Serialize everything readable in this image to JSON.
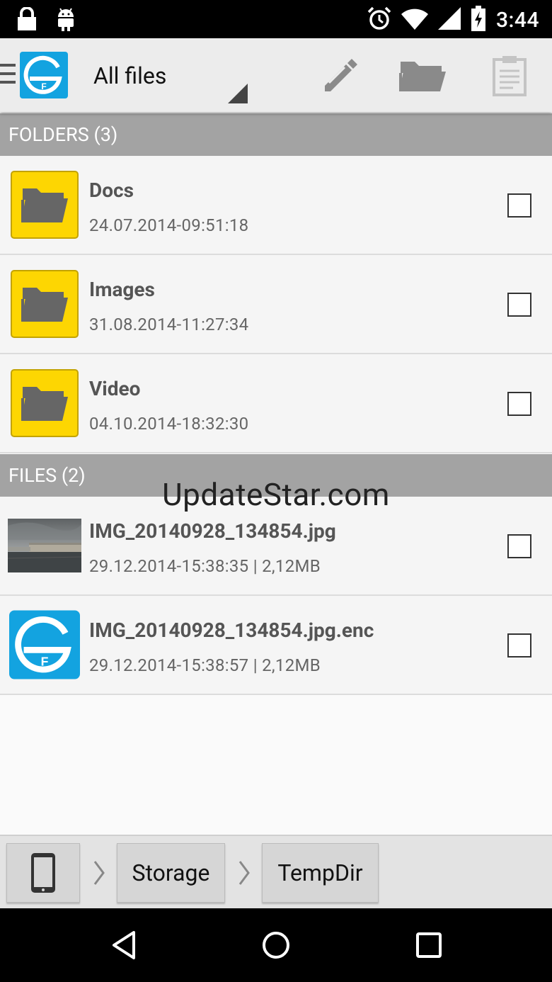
{
  "status_bar": {
    "time": "3:44",
    "icons": [
      "lock-icon",
      "android-icon",
      "alarm-icon",
      "wifi-icon",
      "signal-icon",
      "battery-charging-icon"
    ]
  },
  "action_bar": {
    "title": "All files",
    "actions": [
      "edit-icon",
      "folder-icon",
      "clipboard-icon"
    ]
  },
  "folders": {
    "header": "FOLDERS (3)",
    "items": [
      {
        "name": "Docs",
        "meta": "24.07.2014-09:51:18"
      },
      {
        "name": "Images",
        "meta": "31.08.2014-11:27:34"
      },
      {
        "name": "Video",
        "meta": "04.10.2014-18:32:30"
      }
    ]
  },
  "files": {
    "header": "FILES (2)",
    "items": [
      {
        "name": "IMG_20140928_134854.jpg",
        "meta": "29.12.2014-15:38:35 | 2,12MB"
      },
      {
        "name": "IMG_20140928_134854.jpg.enc",
        "meta": "29.12.2014-15:38:57 | 2,12MB"
      }
    ]
  },
  "watermark": "UpdateStar.com",
  "breadcrumb": {
    "items": [
      "Storage",
      "TempDir"
    ]
  },
  "colors": {
    "accent": "#13a3e0",
    "folder": "#fdd602",
    "section_header": "#a3a3a3"
  }
}
